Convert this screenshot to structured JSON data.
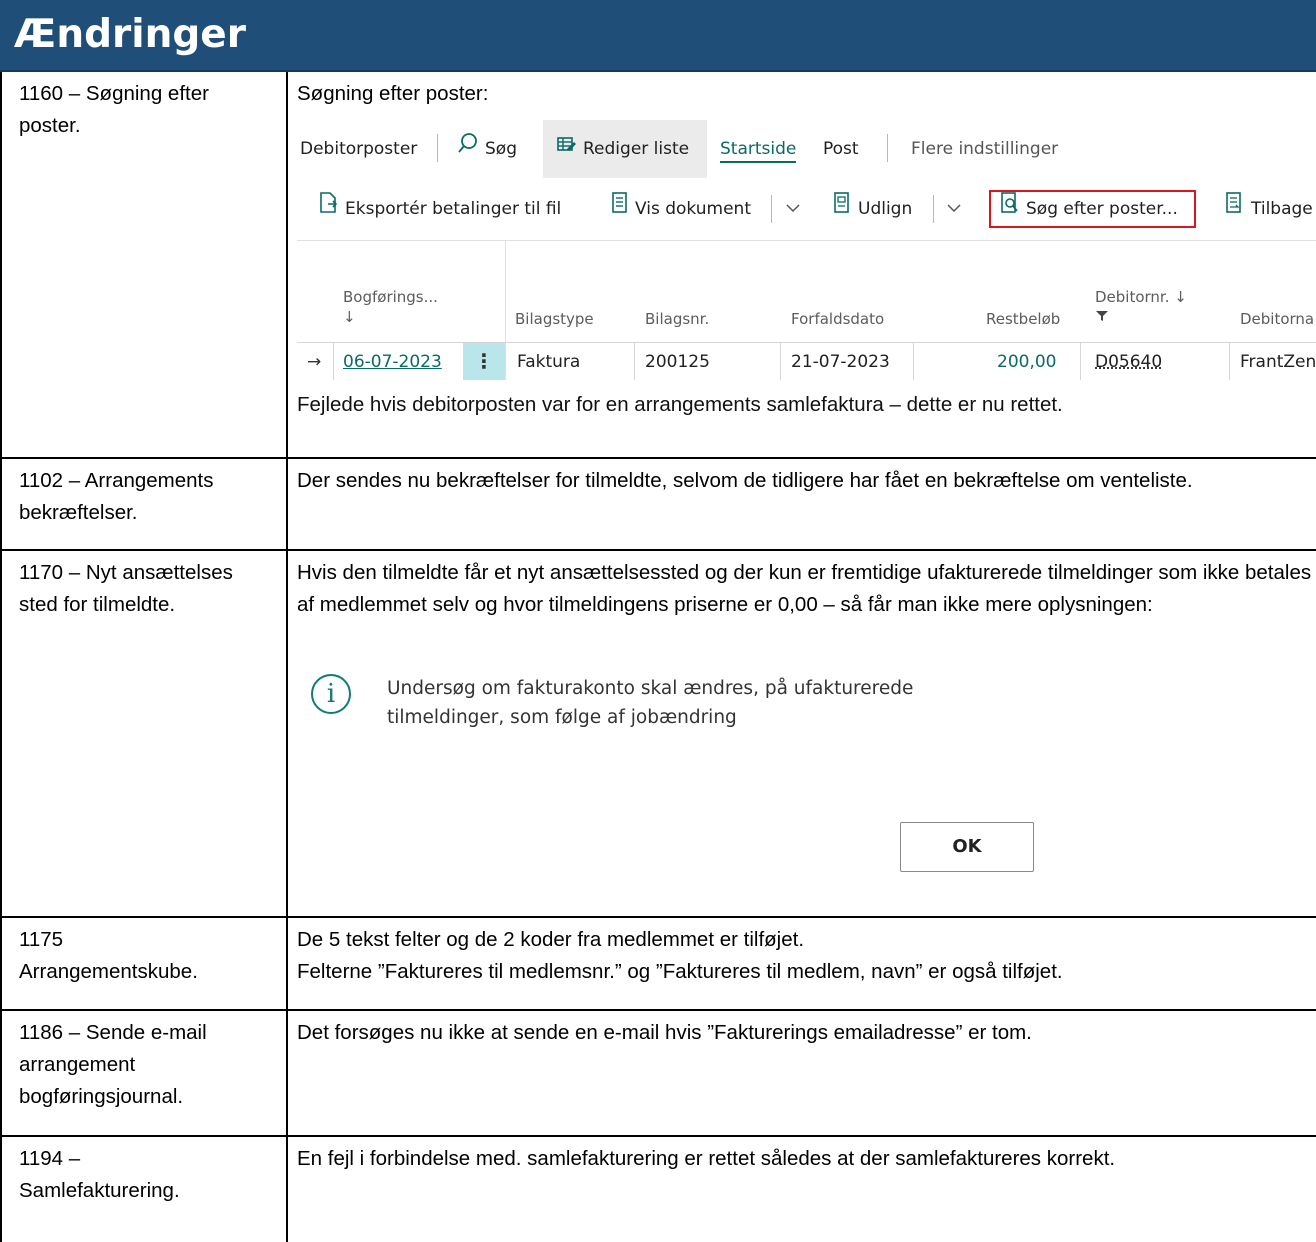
{
  "header": {
    "title": "Ændringer"
  },
  "rows": [
    {
      "id": "1160",
      "left": "1160 – Søgning efter\nposter.",
      "right_top": "Søgning efter poster:",
      "right_bottom": "Fejlede hvis debitorposten var for en arrangements samlefaktura – dette er nu rettet."
    },
    {
      "id": "1102",
      "left": "1102 – Arrangements\nbekræftelser.",
      "right_top": "Der sendes nu bekræftelser for tilmeldte, selvom de tidligere har fået en bekræftelse om venteliste."
    },
    {
      "id": "1170",
      "left": "1170 – Nyt ansættelses\nsted for tilmeldte.",
      "right_top": "Hvis den tilmeldte får et nyt ansættelsessted og der kun er fremtidige ufakturerede tilmeldinger som ikke betales af medlemmet selv og hvor tilmeldingens priserne er 0,00 – så får man ikke mere oplysningen:"
    },
    {
      "id": "1175",
      "left": "1175\nArrangementskube.",
      "right_top": "De 5 tekst felter og de 2 koder fra medlemmet er tilføjet.",
      "right_bottom": "Felterne ”Faktureres til medlemsnr.” og ”Faktureres til medlem, navn” er også tilføjet."
    },
    {
      "id": "1186",
      "left": "1186 – Sende e-mail\narrangement\nbogføringsjournal.",
      "right_top": "Det forsøges nu ikke at sende en e-mail hvis ”Fakturerings emailadresse” er tom."
    },
    {
      "id": "1194",
      "left": "1194 –\nSamlefakturering.",
      "right_top": "En fejl i forbindelse med. samlefakturering er rettet således at der samlefaktureres korrekt."
    }
  ],
  "bc": {
    "tabs": {
      "page": "Debitorposter",
      "search": "Søg",
      "edit_list": "Rediger liste",
      "home": "Startside",
      "post": "Post",
      "more": "Flere indstillinger"
    },
    "actions": {
      "export": "Eksportér betalinger til fil",
      "show_doc": "Vis dokument",
      "apply": "Udlign",
      "find_entries": "Søg efter poster...",
      "reverse": "Tilbage"
    },
    "columns": {
      "posting_date": "Bogførings...",
      "doc_type": "Bilagstype",
      "doc_no": "Bilagsnr.",
      "due_date": "Forfaldsdato",
      "remaining": "Restbeløb",
      "customer_no": "Debitornr.",
      "customer_name": "Debitorna"
    },
    "sort_arrow": "↓",
    "row": {
      "arrow": "→",
      "posting_date": "06-07-2023",
      "menu": "⋮",
      "doc_type": "Faktura",
      "doc_no": "200125",
      "due_date": "21-07-2023",
      "remaining": "200,00",
      "customer_no": "D05640",
      "customer_name": "FrantZen"
    }
  },
  "dialog": {
    "icon": "info-icon",
    "message_line1": "Undersøg om fakturakonto skal ændres, på ufakturerede",
    "message_line2": "tilmeldinger, som følge af jobændring",
    "ok": "OK"
  },
  "colors": {
    "header_bg": "#1f4e79",
    "accent_teal": "#0b6a66",
    "highlight_red": "#e0141e",
    "row_menu_bg": "#b9e6ea"
  }
}
